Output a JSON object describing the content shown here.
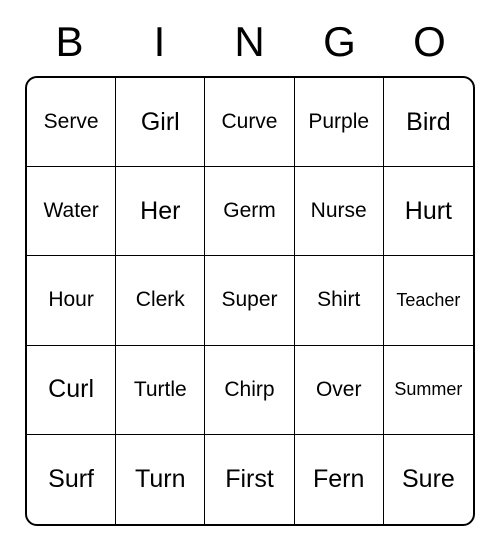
{
  "header": [
    "B",
    "I",
    "N",
    "G",
    "O"
  ],
  "grid": [
    [
      "Serve",
      "Girl",
      "Curve",
      "Purple",
      "Bird"
    ],
    [
      "Water",
      "Her",
      "Germ",
      "Nurse",
      "Hurt"
    ],
    [
      "Hour",
      "Clerk",
      "Super",
      "Shirt",
      "Teacher"
    ],
    [
      "Curl",
      "Turtle",
      "Chirp",
      "Over",
      "Summer"
    ],
    [
      "Surf",
      "Turn",
      "First",
      "Fern",
      "Sure"
    ]
  ]
}
